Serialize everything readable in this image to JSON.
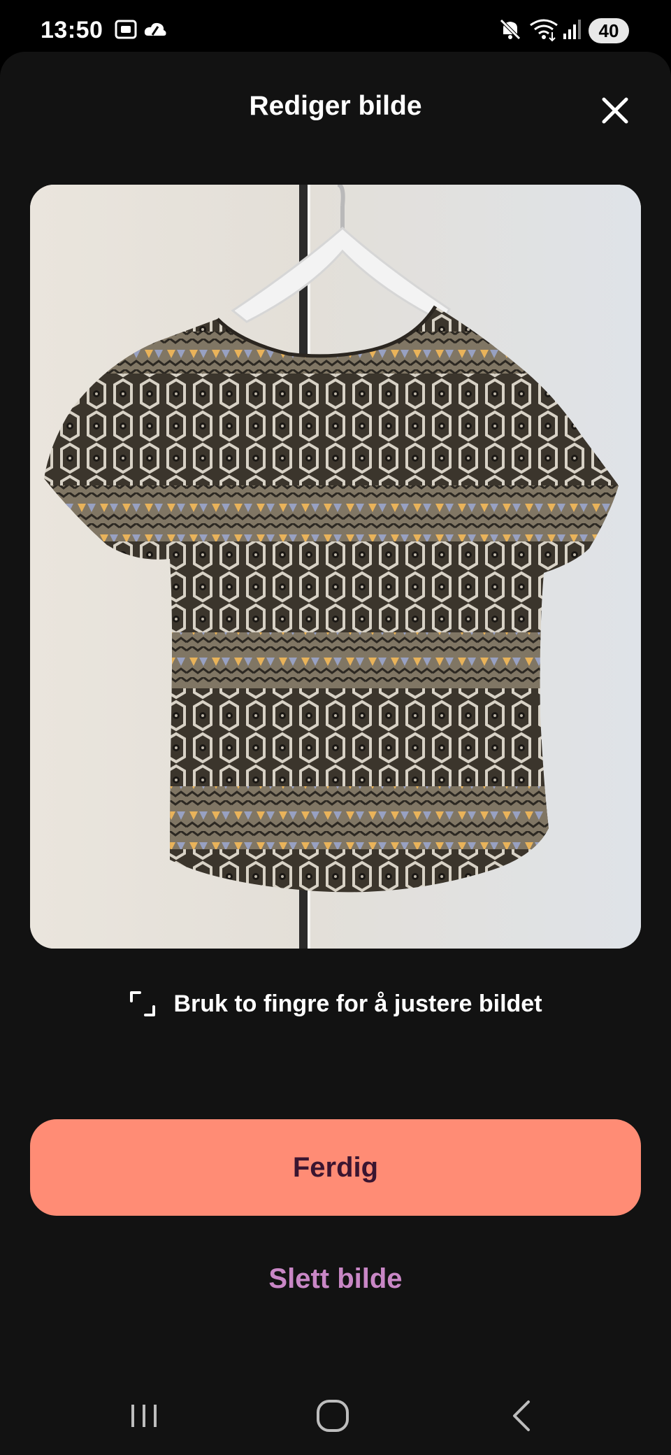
{
  "status_bar": {
    "time": "13:50",
    "battery": "40",
    "icons": [
      "screenshot-icon",
      "cloud-icon",
      "mute-icon",
      "wifi-icon",
      "signal-icon"
    ]
  },
  "dialog": {
    "title": "Rediger bilde",
    "close_icon": "close-icon"
  },
  "photo": {
    "subject": "patterned short-sleeve blouse on white hanger"
  },
  "hint": {
    "icon": "crop-adjust-icon",
    "text": "Bruk to fingre for å justere bildet"
  },
  "actions": {
    "done_label": "Ferdig",
    "delete_label": "Slett bilde"
  },
  "colors": {
    "accent": "#ff8c75",
    "accent_text": "#3a1530",
    "delete_text": "#c987c6",
    "sheet_bg": "#121212"
  },
  "nav_bar": {
    "items": [
      "recent-apps-icon",
      "home-icon",
      "back-icon"
    ]
  }
}
